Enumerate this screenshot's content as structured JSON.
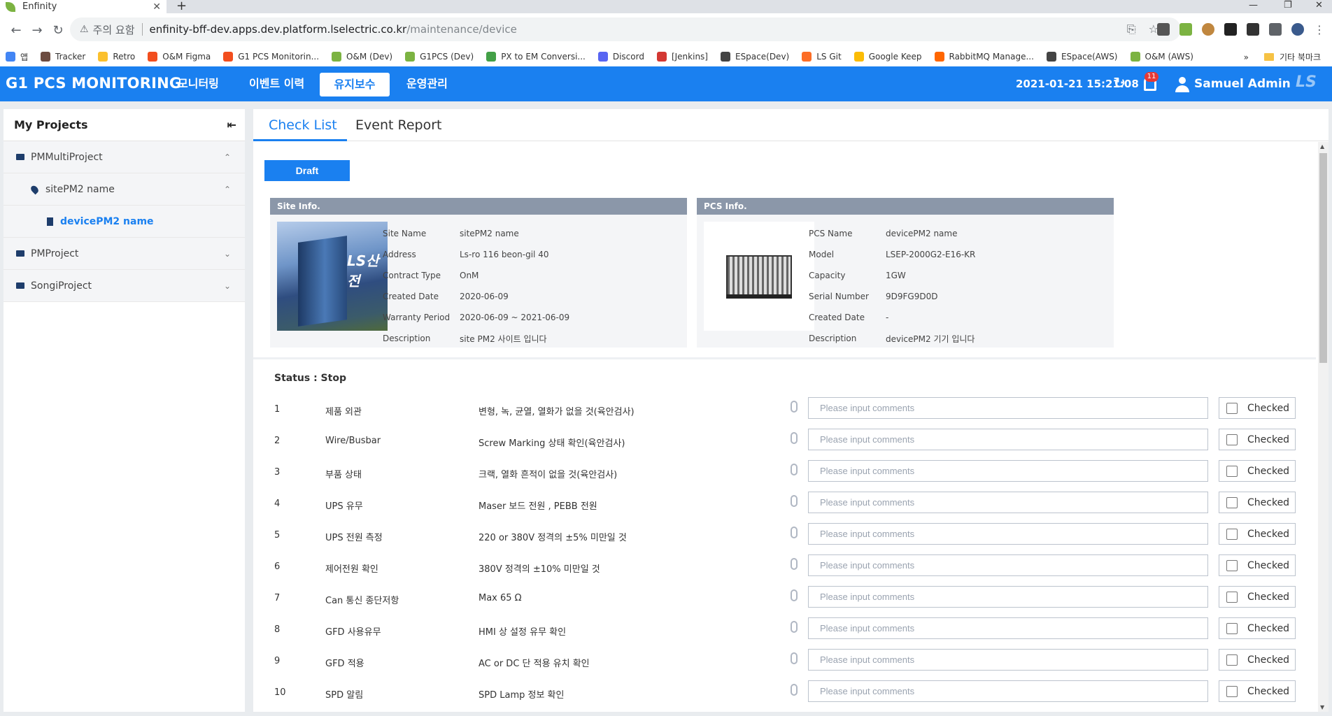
{
  "browser": {
    "tab_title": "Enfinity",
    "tab_close": "✕",
    "new_tab": "+",
    "security_warning": "주의 요함",
    "url_host": "enfinity-bff-dev.apps.dev.platform.lselectric.co.kr",
    "url_path": "/maintenance/device",
    "bookmarks": [
      {
        "label": "앱",
        "color": "#4285f4"
      },
      {
        "label": "Tracker",
        "color": "#6d4c41"
      },
      {
        "label": "Retro",
        "color": "#fbc02d"
      },
      {
        "label": "O&M Figma",
        "color": "#f24e1e"
      },
      {
        "label": "G1 PCS Monitorin...",
        "color": "#f24e1e"
      },
      {
        "label": "O&M (Dev)",
        "color": "#7cb342"
      },
      {
        "label": "G1PCS (Dev)",
        "color": "#7cb342"
      },
      {
        "label": "PX to EM Conversi...",
        "color": "#43a047"
      },
      {
        "label": "Discord",
        "color": "#5865f2"
      },
      {
        "label": "[Jenkins]",
        "color": "#d33833"
      },
      {
        "label": "ESpace(Dev)",
        "color": "#444444"
      },
      {
        "label": "LS Git",
        "color": "#fc6d26"
      },
      {
        "label": "Google Keep",
        "color": "#fbbc04"
      },
      {
        "label": "RabbitMQ Manage...",
        "color": "#ff6600"
      },
      {
        "label": "ESpace(AWS)",
        "color": "#444444"
      },
      {
        "label": "O&M (AWS)",
        "color": "#7cb342"
      }
    ],
    "bookmarks_more": "»",
    "other_bookmarks": "기타 북마크"
  },
  "header": {
    "brand": "G1 PCS MONITORING",
    "nav": [
      "모니터링",
      "이벤트 이력",
      "유지보수",
      "운영관리"
    ],
    "datetime": "2021-01-21 15:21:08",
    "notification_count": "11",
    "user": "Samuel Admin",
    "logo": "LS",
    "accent_color": "#1a80f0"
  },
  "sidebar": {
    "title": "My Projects",
    "items": [
      {
        "label": "PMMultiProject",
        "level": 1,
        "icon": "folder-icon",
        "chevron": "⌃"
      },
      {
        "label": "sitePM2 name",
        "level": 2,
        "icon": "location-pin-icon",
        "chevron": "⌃"
      },
      {
        "label": "devicePM2 name",
        "level": 3,
        "icon": "device-icon",
        "chevron": ""
      },
      {
        "label": "PMProject",
        "level": 1,
        "icon": "folder-icon",
        "chevron": "⌄"
      },
      {
        "label": "SongiProject",
        "level": 1,
        "icon": "folder-icon",
        "chevron": "⌄"
      }
    ]
  },
  "tabs": {
    "active": "Check List",
    "inactive": "Event Report"
  },
  "draft_label": "Draft",
  "site_info": {
    "title": "Site Info.",
    "photo_logo": "LS산전",
    "rows": [
      {
        "label": "Site Name",
        "value": "sitePM2 name"
      },
      {
        "label": "Address",
        "value": "Ls-ro 116 beon-gil 40"
      },
      {
        "label": "Contract Type",
        "value": "OnM"
      },
      {
        "label": "Created Date",
        "value": "2020-06-09"
      },
      {
        "label": "Warranty Period",
        "value": "2020-06-09 ~ 2021-06-09"
      },
      {
        "label": "Description",
        "value": "site PM2 사이트 입니다"
      }
    ]
  },
  "pcs_info": {
    "title": "PCS Info.",
    "rows": [
      {
        "label": "PCS Name",
        "value": "devicePM2 name"
      },
      {
        "label": "Model",
        "value": "LSEP-2000G2-E16-KR"
      },
      {
        "label": "Capacity",
        "value": "1GW"
      },
      {
        "label": "Serial Number",
        "value": "9D9FG9D0D"
      },
      {
        "label": "Created Date",
        "value": "-"
      },
      {
        "label": "Description",
        "value": "devicePM2 기기 입니다"
      }
    ]
  },
  "status_text": "Status : Stop",
  "checklist": {
    "placeholder": "Please input comments",
    "checked_label": "Checked",
    "rows": [
      {
        "num": "1",
        "item": "제품 외관",
        "criteria": "변형, 녹, 균열, 열화가 없을 것(육안검사)"
      },
      {
        "num": "2",
        "item": "Wire/Busbar",
        "criteria": "Screw Marking 상태 확인(육안검사)"
      },
      {
        "num": "3",
        "item": "부품 상태",
        "criteria": "크랙, 열화 흔적이 없을 것(육안검사)"
      },
      {
        "num": "4",
        "item": "UPS 유무",
        "criteria": "Maser 보드 전원 , PEBB 전원"
      },
      {
        "num": "5",
        "item": "UPS 전원 측정",
        "criteria": "220 or 380V 정격의 ±5% 미만일 것"
      },
      {
        "num": "6",
        "item": "제어전원 확인",
        "criteria": "380V 정격의 ±10% 미만일 것"
      },
      {
        "num": "7",
        "item": "Can 통신 종단저항",
        "criteria": "Max 65 Ω"
      },
      {
        "num": "8",
        "item": "GFD 사용유무",
        "criteria": "HMI 상 설정 유무 확인"
      },
      {
        "num": "9",
        "item": "GFD 적용",
        "criteria": "AC or DC 단 적용 유치 확인"
      },
      {
        "num": "10",
        "item": "SPD 알림",
        "criteria": "SPD Lamp 정보 확인"
      }
    ]
  }
}
